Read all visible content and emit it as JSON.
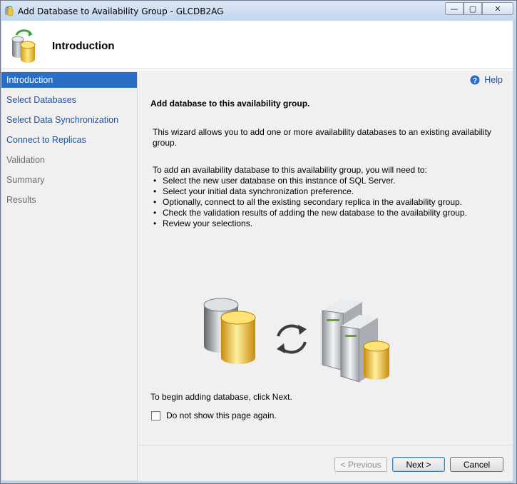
{
  "window": {
    "title": "Add Database to Availability Group - GLCDB2AG",
    "minimize_glyph": "—",
    "maximize_glyph": "▢",
    "close_glyph": "✕"
  },
  "header": {
    "title": "Introduction",
    "icon": "database-wizard-icon"
  },
  "nav": {
    "items": [
      {
        "label": "Introduction",
        "state": "active"
      },
      {
        "label": "Select Databases",
        "state": "link"
      },
      {
        "label": "Select Data Synchronization",
        "state": "link"
      },
      {
        "label": "Connect to Replicas",
        "state": "link"
      },
      {
        "label": "Validation",
        "state": "disabled"
      },
      {
        "label": "Summary",
        "state": "disabled"
      },
      {
        "label": "Results",
        "state": "disabled"
      }
    ]
  },
  "content": {
    "help_label": "Help",
    "section_title": "Add database to this availability group.",
    "description": "This wizard allows you to add one or more availability databases to an existing availability group.",
    "steps_intro": "To add an availability database to this availability group, you will need to:",
    "steps": [
      "Select the new user database on this instance of SQL Server.",
      "Select your initial data synchronization preference.",
      "Optionally, connect to all the existing secondary replica in the availability group.",
      "Check the validation results of adding the new database to the availability group.",
      "Review your selections."
    ],
    "begin_text": "To begin adding database, click Next.",
    "checkbox_label": "Do not show this page again.",
    "checkbox_checked": false
  },
  "footer": {
    "previous_label": "< Previous",
    "next_label": "Next >",
    "cancel_label": "Cancel"
  },
  "colors": {
    "nav_active_bg": "#2a6dc5",
    "link": "#1b53a8",
    "panel_bg": "#f0f0f0"
  }
}
